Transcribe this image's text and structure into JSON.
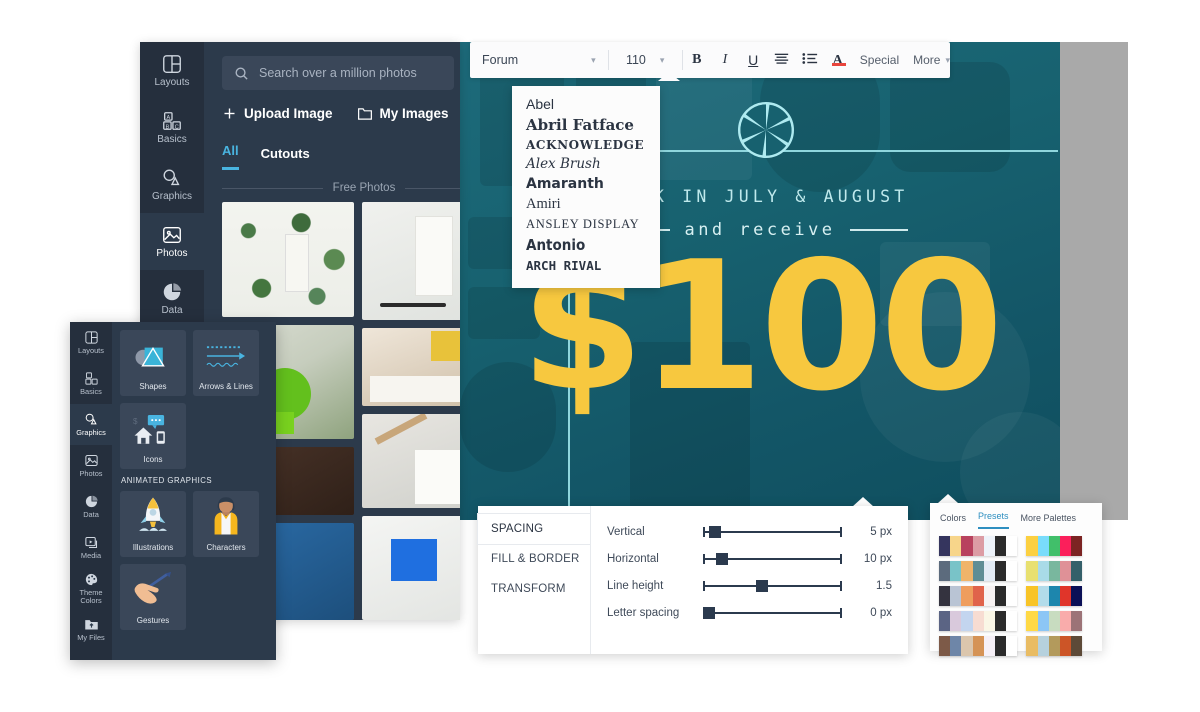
{
  "canvas": {
    "headline_top": "BOOK IN JULY & AUGUST",
    "headline_mid": "and receive",
    "price": "$100",
    "aperture_icon": "aperture-icon",
    "bg_color": "#17616f",
    "accent_color": "#f7c83f",
    "frame_color": "#8fd6dd"
  },
  "photos_panel": {
    "search": {
      "placeholder": "Search over a million photos",
      "icon": "search-icon"
    },
    "upload_buttons": [
      {
        "label": "Upload Image",
        "icon": "plus-icon"
      },
      {
        "label": "My Images",
        "icon": "folder-icon"
      }
    ],
    "tabs": [
      {
        "label": "All",
        "active": true
      },
      {
        "label": "Cutouts",
        "active": false
      }
    ],
    "section_label": "Free Photos",
    "rail": [
      {
        "label": "Layouts",
        "icon": "layouts-icon",
        "active": false
      },
      {
        "label": "Basics",
        "icon": "basics-blocks-icon",
        "active": false
      },
      {
        "label": "Graphics",
        "icon": "graphics-shape-icon",
        "active": false
      },
      {
        "label": "Photos",
        "icon": "photos-image-icon",
        "active": true
      },
      {
        "label": "Data",
        "icon": "data-pie-icon",
        "active": false
      }
    ]
  },
  "graphics_panel": {
    "rail": [
      {
        "label": "Layouts",
        "icon": "layouts-icon",
        "active": false
      },
      {
        "label": "Basics",
        "icon": "basics-blocks-icon",
        "active": false
      },
      {
        "label": "Graphics",
        "icon": "graphics-shape-icon",
        "active": true
      },
      {
        "label": "Photos",
        "icon": "photos-image-icon",
        "active": false
      },
      {
        "label": "Data",
        "icon": "data-pie-icon",
        "active": false
      },
      {
        "label": "Media",
        "icon": "media-icon",
        "active": false
      },
      {
        "label": "Theme Colors",
        "icon": "palette-icon",
        "active": false
      },
      {
        "label": "My Files",
        "icon": "my-files-icon",
        "active": false
      }
    ],
    "tiles_top": [
      {
        "label": "Shapes",
        "icon": "shapes-icon"
      },
      {
        "label": "Arrows & Lines",
        "icon": "arrows-lines-icon"
      },
      {
        "label": "Icons",
        "icon": "icons-house-icon"
      }
    ],
    "section_label": "ANIMATED GRAPHICS",
    "tiles_animated": [
      {
        "label": "Illustrations",
        "icon": "rocket-icon"
      },
      {
        "label": "Characters",
        "icon": "character-icon"
      },
      {
        "label": "Gestures",
        "icon": "hand-gesture-icon"
      }
    ]
  },
  "text_toolbar": {
    "font_family": "Forum",
    "font_size": "110",
    "bold": "B",
    "italic": "I",
    "underline": "U",
    "align": "align-left-icon",
    "list": "bullet-list-icon",
    "text_color": "A",
    "special_label": "Special",
    "more_label": "More",
    "text_color_swatch": "#e8453c"
  },
  "font_dropdown": {
    "items": [
      "Abel",
      "Abril Fatface",
      "ACKNOWLEDGE",
      "Alex Brush",
      "Amaranth",
      "Amiri",
      "ANSLEY DISPLAY",
      "Antonio",
      "ARCH RIVAL"
    ]
  },
  "spacing_popup": {
    "tabs": [
      {
        "label": "SPACING",
        "active": true
      },
      {
        "label": "FILL & BORDER",
        "active": false
      },
      {
        "label": "TRANSFORM",
        "active": false
      }
    ],
    "rows": [
      {
        "label": "Vertical",
        "value": "5 px",
        "pos": 4
      },
      {
        "label": "Horizontal",
        "value": "10 px",
        "pos": 9
      },
      {
        "label": "Line height",
        "value": "1.5",
        "pos": 38
      },
      {
        "label": "Letter spacing",
        "value": "0 px",
        "pos": 0
      }
    ]
  },
  "palette_popup": {
    "tabs": [
      {
        "label": "Colors",
        "active": false
      },
      {
        "label": "Presets",
        "active": true
      },
      {
        "label": "More Palettes",
        "active": false
      }
    ],
    "rows": [
      {
        "left": [
          "#35355e",
          "#f7d58a",
          "#b8425e",
          "#dc9ca4",
          "#eef3fa",
          "#2b2b2b",
          "#ffffff"
        ],
        "right": [
          "#fcd041",
          "#79dcfb",
          "#41bf6a",
          "#fb1f5b",
          "#7c2423"
        ]
      },
      {
        "left": [
          "#5c6b7d",
          "#79c3c8",
          "#f0b46a",
          "#5f8d95",
          "#e3ebf5",
          "#2b2b2b",
          "#ffffff"
        ],
        "right": [
          "#e8e070",
          "#a9dbe8",
          "#79b79e",
          "#df9197",
          "#35606a"
        ]
      },
      {
        "left": [
          "#34333f",
          "#b9c4d4",
          "#ef9d5d",
          "#e0634b",
          "#f7f2f2",
          "#2b2b2b",
          "#ffffff"
        ],
        "right": [
          "#f8c427",
          "#b3dcea",
          "#1d86ad",
          "#e0352a",
          "#0b1057"
        ]
      },
      {
        "left": [
          "#5b6484",
          "#d9c9dc",
          "#c3d5ef",
          "#f7dcd2",
          "#faf6e6",
          "#2b2b2b",
          "#ffffff"
        ],
        "right": [
          "#ffd945",
          "#8cc6f5",
          "#c8dcc0",
          "#f9acab",
          "#9c7377"
        ]
      },
      {
        "left": [
          "#7d5a48",
          "#6e86a8",
          "#dbc6ad",
          "#d59356",
          "#f6f0f7",
          "#2b2b2b",
          "#ffffff"
        ],
        "right": [
          "#e9bc63",
          "#b6d1dd",
          "#b39a5c",
          "#cc5527",
          "#5d4a38"
        ]
      }
    ]
  }
}
